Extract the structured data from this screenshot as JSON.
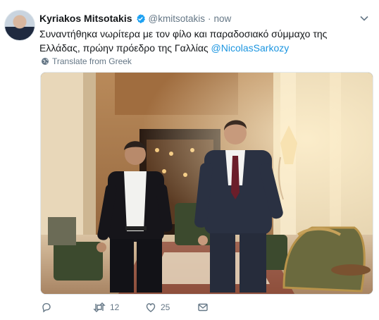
{
  "author": {
    "name": "Kyriakos Mitsotakis",
    "handle": "@kmitsotakis",
    "separator": "·",
    "time": "now"
  },
  "tweet": {
    "text_line1": "Συναντήθηκα νωρίτερα με τον φίλο και παραδοσιακό σύμμαχο της",
    "text_line2": "Ελλάδας, πρώην πρόεδρο της Γαλλίας ",
    "mention": "@NicolasSarkozy",
    "translate_label": "Translate from Greek"
  },
  "actions": {
    "reply_count": "",
    "retweet_count": "12",
    "like_count": "25"
  },
  "colors": {
    "accent": "#1b95e0",
    "muted": "#657786",
    "text": "#14171a",
    "verified": "#1da1f2"
  },
  "icons": [
    "chevron-down-icon",
    "verified-badge-icon",
    "globe-icon",
    "reply-icon",
    "retweet-icon",
    "like-icon",
    "message-icon"
  ]
}
